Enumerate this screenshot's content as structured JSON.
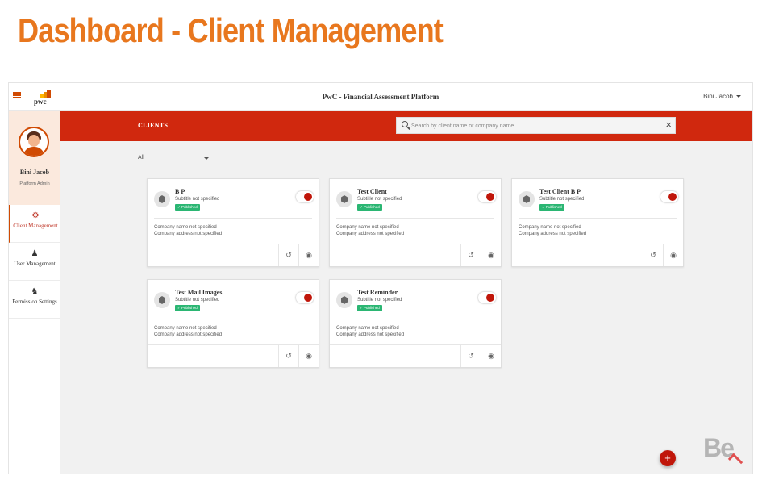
{
  "slide": {
    "heading": "Dashboard - Client Management"
  },
  "header": {
    "logo_text": "pwc",
    "app_title": "PwC - Financial Assessment Platform",
    "user_name": "Bini Jacob"
  },
  "sidebar": {
    "profile": {
      "name": "Bini Jacob",
      "role": "Platform Admin"
    },
    "items": [
      {
        "label": "Client Management",
        "icon": "client-management-icon",
        "active": true
      },
      {
        "label": "User Management",
        "icon": "user-management-icon",
        "active": false
      },
      {
        "label": "Permission Settings",
        "icon": "permission-settings-icon",
        "active": false
      }
    ]
  },
  "main": {
    "section_title": "CLIENTS",
    "search": {
      "placeholder": "Search by client name or company name",
      "value": ""
    },
    "filter": {
      "selected": "All"
    },
    "cards": [
      {
        "name": "B P",
        "subtitle": "Subtitle not specified",
        "status": "✓ Published",
        "company": "Company name not specified",
        "address": "Company address not specified",
        "toggle_on": true
      },
      {
        "name": "Test Client",
        "subtitle": "Subtitle not specified",
        "status": "✓ Published",
        "company": "Company name not specified",
        "address": "Company address not specified",
        "toggle_on": true
      },
      {
        "name": "Test Client B P",
        "subtitle": "Subtitle not specified",
        "status": "✓ Published",
        "company": "Company name not specified",
        "address": "Company address not specified",
        "toggle_on": true
      },
      {
        "name": "Test Mail Images",
        "subtitle": "Subtitle not specified",
        "status": "✓ Published",
        "company": "Company name not specified",
        "address": "Company address not specified",
        "toggle_on": true
      },
      {
        "name": "Test Reminder",
        "subtitle": "Subtitle not specified",
        "status": "✓ Published",
        "company": "Company name not specified",
        "address": "Company address not specified",
        "toggle_on": true
      }
    ],
    "fab_label": "+"
  },
  "watermark": {
    "text": "Be"
  },
  "colors": {
    "brand_orange": "#d04a02",
    "banner_red": "#d0280e",
    "heading_orange": "#e8771e",
    "published_green": "#2bb673",
    "toggle_red": "#c0160a"
  }
}
